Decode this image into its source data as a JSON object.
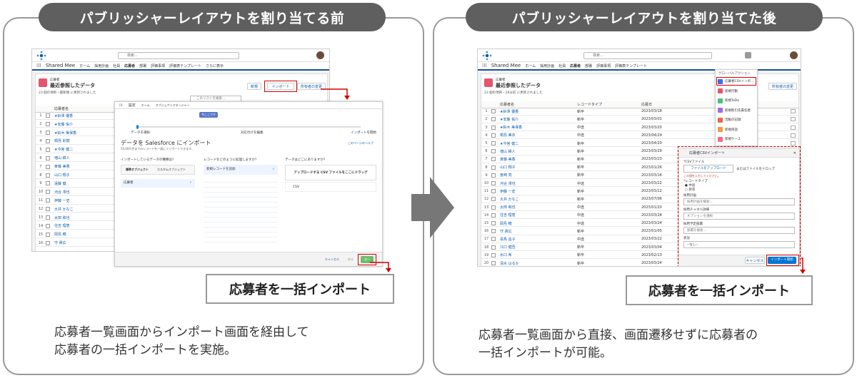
{
  "left_panel": {
    "title": "パブリッシャーレイアウトを割り当てる前",
    "action_label": "応募者を一括インポート",
    "caption_line1": "応募者一覧画面からインポート画面を経由して",
    "caption_line2": "応募者の一括インポートを実施。"
  },
  "right_panel": {
    "title": "パブリッシャーレイアウトを割り当てた後",
    "action_label": "応募者を一括インポート",
    "caption_line1": "応募者一覧画面から直接、画面遷移せずに応募者の",
    "caption_line2": "一括インポートが可能。"
  },
  "app": {
    "search_placeholder": "検索...",
    "app_name": "Shared Mee",
    "nav": [
      "ホーム",
      "採用計画",
      "社員",
      "応募者",
      "部署",
      "評価事項",
      "評価表テンプレート",
      "さらに表示"
    ],
    "object_label": "応募者",
    "list_view": "最近参照したデータ",
    "list_meta_left": "23 個の項目・最新順 に更新されました",
    "list_meta_right": "23 個の項目・26分前 に更新されました",
    "btn_new": "新規",
    "btn_import": "インポート",
    "btn_change_owner": "所有者の変更",
    "list_search": "このリストを検索...",
    "col_name": "応募者名",
    "col_record_type": "レコードタイプ",
    "col_date": "応募日",
    "names_left": [
      "★鈴澤 優香",
      "★安藤 佑介",
      "★鈴木 美保香",
      "桐島 彩樹",
      "★今宮 健二",
      "増山 耕人",
      "斉藤 美香",
      "山口 翔子",
      "遠藤 健",
      "河合 澪也",
      "伊藤 一史",
      "大井 かなこ",
      "太田 和也",
      "住吉 理恵",
      "岡島 穂",
      "守 貴広"
    ],
    "names_right": [
      "★鈴澤 優香",
      "★安藤 佑介",
      "★鈴木 美保香",
      "桐島 美衣",
      "★今宮 健二",
      "増山 耕人",
      "斉藤 美香",
      "山口 翔子",
      "宮崎 亮",
      "河合 澪也",
      "伊藤 一史",
      "大井 かなこ",
      "太田 和也",
      "住吉 理恵",
      "岡島 穂",
      "守 貴広",
      "喜馬 遥子",
      "江口 健吾",
      "水口 希",
      "深水 はるか"
    ],
    "types_right": [
      "新卒",
      "新卒",
      "中途",
      "中途",
      "新卒",
      "新卒",
      "新卒",
      "新卒",
      "新卒",
      "中途",
      "新卒",
      "新卒",
      "中途",
      "中途",
      "中途",
      "新卒",
      "中途",
      "新卒",
      "新卒",
      "新卒"
    ],
    "dates_right": [
      "2023/03/18",
      "2023/03/01",
      "2023/03/20",
      "2023/04/29",
      "2023/04/20",
      "2023/03/29",
      "2023/03/23",
      "2023/01/26",
      "2023/03/16",
      "2023/03/22",
      "2023/03/12",
      "2023/07/06",
      "2023/01/20",
      "2023/03/28",
      "2023/03/24",
      "2023/01/05",
      "2023/03/22",
      "2023/03/04",
      "2023/02/13",
      "2023/03/24"
    ]
  },
  "wizard": {
    "setup": "設定",
    "tab_home": "ホーム",
    "tab_object_manager": "オブジェクトマネージャー",
    "step_badge": "今ここです",
    "step1": "データを選択",
    "step2": "対応付けを編集",
    "step3": "インポートを開始",
    "title": "データを Salesforce にインポート",
    "subtitle": "50,000 件までのレコードを一度にインポートできます。",
    "help": "このページのヘルプ",
    "q1": "インポートしているデータの種類は? ",
    "q2": "レコードをどのように処理しますか? ",
    "q3": "データはどこにありますか? ",
    "tab_standard": "標準オブジェクト",
    "tab_custom": "カスタムオブジェクト",
    "obj": "応募者",
    "opt_add": "新規レコードを追加",
    "drop": "アップロードする CSV ファイルをここにドラッグ",
    "csv": "CSV",
    "cancel": "キャンセル",
    "back": "戻る",
    "next": "次へ"
  },
  "quick_action": {
    "menu_header": "グローバルアクション",
    "menu_items": [
      "応募者CSVインポ...",
      "新規行動",
      "新規ToDo",
      "新規取引先責任者",
      "活動の記録",
      "新規商談",
      "新規ケース"
    ],
    "menu_colors": [
      "#3b6ee8",
      "#e3566d",
      "#4bc076",
      "#a16ae6",
      "#e36a4b",
      "#f79a3b",
      "#f26891"
    ],
    "modal_title": "応募者CSVインポート",
    "file_label": "*CSVファイル",
    "upload_btn": "ファイルをアップロード",
    "or_drop": "またはファイルをドロップ",
    "error": "この値を入力してください。",
    "record_type_label": "*レコードタイプ",
    "rt_midcareer": "中途",
    "rt_newgrad": "新卒",
    "plan_label": "採用計画",
    "plan_placeholder": "採用計画を検索...",
    "channel_label": "採用チャネル詳細",
    "channel_placeholder": "オプションを選択",
    "dept_label": "採用予定部署",
    "dept_placeholder": "部署を検索...",
    "status_label": "状況",
    "status_value": "--なし--",
    "btn_cancel": "キャンセル",
    "btn_start": "インポート開始"
  },
  "colors": {
    "accent_red": "#d40000",
    "pill_bg": "#5f5f5f",
    "sf_blue": "#0b5cab",
    "brand": "#1b5297"
  }
}
